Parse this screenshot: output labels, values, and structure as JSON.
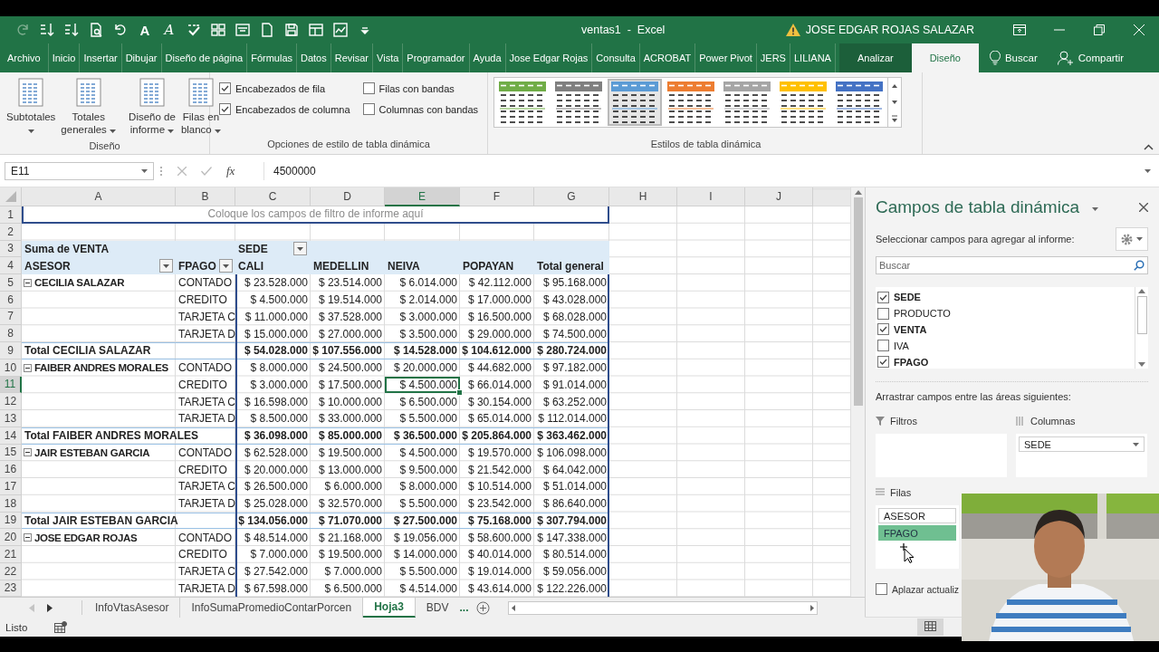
{
  "title_bar": {
    "quick_access": [
      {
        "kind": "redo",
        "disabled": true
      },
      {
        "kind": "sort_asc",
        "disabled": false
      },
      {
        "kind": "sort_desc",
        "disabled": false
      },
      {
        "kind": "print_preview",
        "disabled": false
      },
      {
        "kind": "undo",
        "disabled": false
      },
      {
        "kind": "letter",
        "text": "A",
        "disabled": false
      },
      {
        "kind": "letter_italic",
        "text": "A",
        "disabled": false
      },
      {
        "kind": "spell_check",
        "disabled": false
      },
      {
        "kind": "grid",
        "disabled": false
      },
      {
        "kind": "form",
        "disabled": false
      },
      {
        "kind": "page",
        "disabled": false
      },
      {
        "kind": "save",
        "disabled": false
      },
      {
        "kind": "window",
        "disabled": false
      },
      {
        "kind": "chart",
        "disabled": false
      },
      {
        "kind": "more",
        "disabled": false
      }
    ],
    "title": "ventas1  -  Excel",
    "user": "JOSE EDGAR ROJAS SALAZAR"
  },
  "tabs": [
    {
      "label": "Archivo",
      "selected": false,
      "contextual": false
    },
    {
      "label": "Inicio",
      "selected": false,
      "contextual": false
    },
    {
      "label": "Insertar",
      "selected": false,
      "contextual": false
    },
    {
      "label": "Dibujar",
      "selected": false,
      "contextual": false
    },
    {
      "label": "Diseño de página",
      "selected": false,
      "contextual": false
    },
    {
      "label": "Fórmulas",
      "selected": false,
      "contextual": false
    },
    {
      "label": "Datos",
      "selected": false,
      "contextual": false
    },
    {
      "label": "Revisar",
      "selected": false,
      "contextual": false
    },
    {
      "label": "Vista",
      "selected": false,
      "contextual": false
    },
    {
      "label": "Programador",
      "selected": false,
      "contextual": false
    },
    {
      "label": "Ayuda",
      "selected": false,
      "contextual": false
    },
    {
      "label": "Jose Edgar Rojas",
      "selected": false,
      "contextual": false
    },
    {
      "label": "Consulta",
      "selected": false,
      "contextual": false
    },
    {
      "label": "ACROBAT",
      "selected": false,
      "contextual": false
    },
    {
      "label": "Power Pivot",
      "selected": false,
      "contextual": false
    },
    {
      "label": "JERS",
      "selected": false,
      "contextual": false
    },
    {
      "label": "LILIANA",
      "selected": false,
      "contextual": false
    },
    {
      "label": "Analizar",
      "selected": false,
      "contextual": true
    },
    {
      "label": "Diseño",
      "selected": true,
      "contextual": true
    }
  ],
  "tell_me": "Buscar",
  "share": "Compartir",
  "ribbon": {
    "layout_group": {
      "label": "Diseño",
      "buttons": [
        {
          "lines": [
            "Subtotales"
          ],
          "dropdown": true
        },
        {
          "lines": [
            "Totales",
            "generales"
          ],
          "dropdown": true
        },
        {
          "lines": [
            "Diseño de",
            "informe"
          ],
          "dropdown": true
        },
        {
          "lines": [
            "Filas en",
            "blanco"
          ],
          "dropdown": true
        }
      ]
    },
    "options_group": {
      "label": "Opciones de estilo de tabla dinámica",
      "options": [
        {
          "label": "Encabezados de fila",
          "checked": true
        },
        {
          "label": "Filas con bandas",
          "checked": false
        },
        {
          "label": "Encabezados de columna",
          "checked": true
        },
        {
          "label": "Columnas con bandas",
          "checked": false
        }
      ]
    },
    "styles_group": {
      "label": "Estilos de tabla dinámica",
      "styles": [
        {
          "color": "#70ad47",
          "selected": false
        },
        {
          "color": "#7f7f7f",
          "selected": false
        },
        {
          "color": "#5b9bd5",
          "selected": true
        },
        {
          "color": "#ed7d31",
          "selected": false
        },
        {
          "color": "#a5a5a5",
          "selected": false
        },
        {
          "color": "#ffc000",
          "selected": false
        },
        {
          "color": "#4472c4",
          "selected": false
        }
      ]
    }
  },
  "formula_bar": {
    "name_box": "E11",
    "function_label": "fx",
    "value": "4500000"
  },
  "sheet": {
    "columns": [
      {
        "label": "A",
        "selected": false
      },
      {
        "label": "B",
        "selected": false
      },
      {
        "label": "C",
        "selected": false
      },
      {
        "label": "D",
        "selected": false
      },
      {
        "label": "E",
        "selected": true
      },
      {
        "label": "F",
        "selected": false
      },
      {
        "label": "G",
        "selected": false
      },
      {
        "label": "H",
        "selected": false
      },
      {
        "label": "I",
        "selected": false
      },
      {
        "label": "J",
        "selected": false
      }
    ],
    "rows": [
      {
        "number": "1",
        "selected": false,
        "kind": "filter_hint",
        "cells": [
          "Coloque los campos de filtro de informe aquí"
        ]
      },
      {
        "number": "2",
        "selected": false,
        "kind": "blank"
      },
      {
        "number": "3",
        "selected": false,
        "kind": "title",
        "cells": [
          "Suma de VENTA",
          "",
          "SEDE"
        ]
      },
      {
        "number": "4",
        "selected": false,
        "kind": "header",
        "cells": [
          "ASESOR",
          "FPAGO",
          "CALI",
          "MEDELLIN",
          "NEIVA",
          "POPAYAN",
          "Total general"
        ]
      },
      {
        "number": "5",
        "selected": false,
        "kind": "group",
        "expanded": true,
        "cells": [
          "CECILIA SALAZAR",
          "CONTADO",
          "$ 23.528.000",
          "$ 23.514.000",
          "$ 6.014.000",
          "$ 42.112.000",
          "$ 95.168.000"
        ]
      },
      {
        "number": "6",
        "selected": false,
        "kind": "detail",
        "cells": [
          "",
          "CREDITO",
          "$ 4.500.000",
          "$ 19.514.000",
          "$ 2.014.000",
          "$ 17.000.000",
          "$ 43.028.000"
        ]
      },
      {
        "number": "7",
        "selected": false,
        "kind": "detail",
        "cells": [
          "",
          "TARJETA C",
          "$ 11.000.000",
          "$ 37.528.000",
          "$ 3.000.000",
          "$ 16.500.000",
          "$ 68.028.000"
        ]
      },
      {
        "number": "8",
        "selected": false,
        "kind": "detail",
        "cells": [
          "",
          "TARJETA D",
          "$ 15.000.000",
          "$ 27.000.000",
          "$ 3.500.000",
          "$ 29.000.000",
          "$ 74.500.000"
        ]
      },
      {
        "number": "9",
        "selected": false,
        "kind": "total",
        "cells": [
          "Total CECILIA SALAZAR",
          "",
          "$ 54.028.000",
          "$ 107.556.000",
          "$ 14.528.000",
          "$ 104.612.000",
          "$ 280.724.000"
        ]
      },
      {
        "number": "10",
        "selected": false,
        "kind": "group",
        "expanded": true,
        "cells": [
          "FAIBER ANDRES MORALES",
          "CONTADO",
          "$ 8.000.000",
          "$ 24.500.000",
          "$ 20.000.000",
          "$ 44.682.000",
          "$ 97.182.000"
        ]
      },
      {
        "number": "11",
        "selected": true,
        "kind": "detail",
        "cells": [
          "",
          "CREDITO",
          "$ 3.000.000",
          "$ 17.500.000",
          "$ 4.500.000",
          "$ 66.014.000",
          "$ 91.014.000"
        ]
      },
      {
        "number": "12",
        "selected": false,
        "kind": "detail",
        "cells": [
          "",
          "TARJETA C",
          "$ 16.598.000",
          "$ 10.000.000",
          "$ 6.500.000",
          "$ 30.154.000",
          "$ 63.252.000"
        ]
      },
      {
        "number": "13",
        "selected": false,
        "kind": "detail",
        "cells": [
          "",
          "TARJETA D",
          "$ 8.500.000",
          "$ 33.000.000",
          "$ 5.500.000",
          "$ 65.014.000",
          "$ 112.014.000"
        ]
      },
      {
        "number": "14",
        "selected": false,
        "kind": "total",
        "cells": [
          "Total FAIBER ANDRES MORALES",
          "",
          "$ 36.098.000",
          "$ 85.000.000",
          "$ 36.500.000",
          "$ 205.864.000",
          "$ 363.462.000"
        ]
      },
      {
        "number": "15",
        "selected": false,
        "kind": "group",
        "expanded": true,
        "cells": [
          "JAIR ESTEBAN GARCIA",
          "CONTADO",
          "$ 62.528.000",
          "$ 19.500.000",
          "$ 4.500.000",
          "$ 19.570.000",
          "$ 106.098.000"
        ]
      },
      {
        "number": "16",
        "selected": false,
        "kind": "detail",
        "cells": [
          "",
          "CREDITO",
          "$ 20.000.000",
          "$ 13.000.000",
          "$ 9.500.000",
          "$ 21.542.000",
          "$ 64.042.000"
        ]
      },
      {
        "number": "17",
        "selected": false,
        "kind": "detail",
        "cells": [
          "",
          "TARJETA C",
          "$ 26.500.000",
          "$ 6.000.000",
          "$ 8.000.000",
          "$ 10.514.000",
          "$ 51.014.000"
        ]
      },
      {
        "number": "18",
        "selected": false,
        "kind": "detail",
        "cells": [
          "",
          "TARJETA D",
          "$ 25.028.000",
          "$ 32.570.000",
          "$ 5.500.000",
          "$ 23.542.000",
          "$ 86.640.000"
        ]
      },
      {
        "number": "19",
        "selected": false,
        "kind": "total",
        "cells": [
          "Total JAIR ESTEBAN GARCIA",
          "",
          "$ 134.056.000",
          "$ 71.070.000",
          "$ 27.500.000",
          "$ 75.168.000",
          "$ 307.794.000"
        ]
      },
      {
        "number": "20",
        "selected": false,
        "kind": "group",
        "expanded": true,
        "cells": [
          "JOSE EDGAR ROJAS",
          "CONTADO",
          "$ 48.514.000",
          "$ 21.168.000",
          "$ 19.056.000",
          "$ 58.600.000",
          "$ 147.338.000"
        ]
      },
      {
        "number": "21",
        "selected": false,
        "kind": "detail",
        "cells": [
          "",
          "CREDITO",
          "$ 7.000.000",
          "$ 19.500.000",
          "$ 14.000.000",
          "$ 40.014.000",
          "$ 80.514.000"
        ]
      },
      {
        "number": "22",
        "selected": false,
        "kind": "detail",
        "cells": [
          "",
          "TARJETA C",
          "$ 27.542.000",
          "$ 7.000.000",
          "$ 5.500.000",
          "$ 19.014.000",
          "$ 59.056.000"
        ]
      },
      {
        "number": "23",
        "selected": false,
        "kind": "detail",
        "cells": [
          "",
          "TARJETA D",
          "$ 67.598.000",
          "$ 6.500.000",
          "$ 4.514.000",
          "$ 43.614.000",
          "$ 122.226.000"
        ]
      }
    ]
  },
  "sheet_tabs": {
    "tabs": [
      {
        "label": "InfoVtasAsesor",
        "selected": false
      },
      {
        "label": "InfoSumaPromedioContarPorcen",
        "selected": false
      },
      {
        "label": "Hoja3",
        "selected": true
      },
      {
        "label": "BDV",
        "selected": false
      }
    ],
    "overflow": "..."
  },
  "status_bar": {
    "text": "Listo"
  },
  "field_panel": {
    "title": "Campos de tabla dinámica",
    "prompt": "Seleccionar campos para agregar al informe:",
    "search_placeholder": "Buscar",
    "fields": [
      {
        "label": "SEDE",
        "checked": true
      },
      {
        "label": "PRODUCTO",
        "checked": false
      },
      {
        "label": "VENTA",
        "checked": true
      },
      {
        "label": "IVA",
        "checked": false
      },
      {
        "label": "FPAGO",
        "checked": true
      }
    ],
    "drag_hint": "Arrastrar campos entre las áreas siguientes:",
    "areas": [
      {
        "kind": "filters",
        "label": "Filtros"
      },
      {
        "kind": "columns",
        "label": "Columnas",
        "items": [
          {
            "label": "SEDE",
            "selected": false
          }
        ]
      },
      {
        "kind": "rows",
        "label": "Filas",
        "items": [
          {
            "label": "ASESOR",
            "selected": false
          },
          {
            "label": "FPAGO",
            "selected": true
          }
        ]
      }
    ],
    "defer_update": {
      "label": "Aplazar actualiz",
      "checked": false
    }
  }
}
